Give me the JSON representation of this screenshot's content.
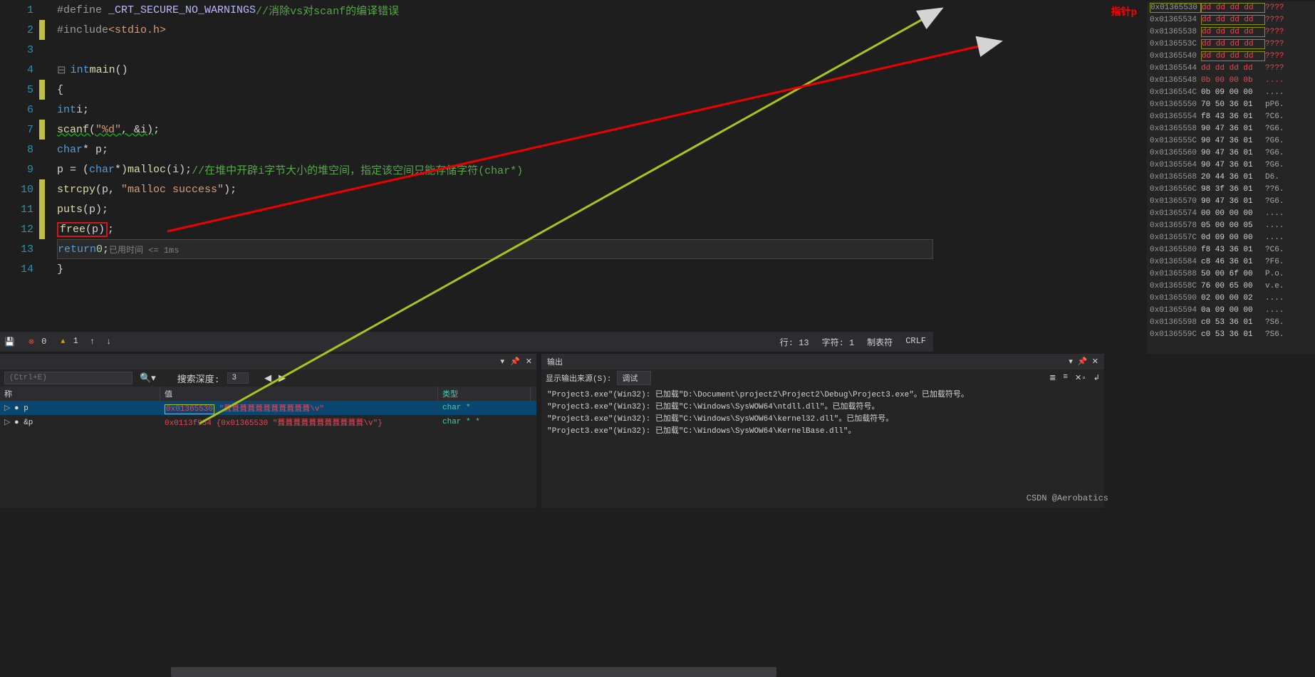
{
  "code": {
    "lines": [
      {
        "n": "1",
        "bk": false,
        "html": "<span class='c-dir'>#define </span><span class='c-mac'>_CRT_SECURE_NO_WARNINGS</span> <span class='c-cmt'>//消除vs对scanf的编译错误</span>"
      },
      {
        "n": "2",
        "bk": true,
        "html": "<span class='c-dir'>#include</span><span class='c-str'>&lt;stdio.h&gt;</span>"
      },
      {
        "n": "3",
        "bk": false,
        "html": ""
      },
      {
        "n": "4",
        "bk": false,
        "html": "<span class='collapse'>⊟</span><span class='c-kw'>int</span> <span class='c-fn'>main</span><span class='c-id'>()</span>"
      },
      {
        "n": "5",
        "bk": true,
        "html": "<span class='c-id'>{</span>"
      },
      {
        "n": "6",
        "bk": false,
        "html": "    <span class='c-kw'>int</span> <span class='c-id'>i;</span>"
      },
      {
        "n": "7",
        "bk": true,
        "html": "    <span class='c-fn squig'>scanf</span><span class='c-id squig'>(</span><span class='c-str squig'>\"%d\"</span><span class='c-id squig'>, &amp;i)</span><span class='c-id'>;</span>"
      },
      {
        "n": "8",
        "bk": false,
        "html": "    <span class='c-kw'>char</span><span class='c-id'>* p;</span>"
      },
      {
        "n": "9",
        "bk": false,
        "html": "    <span class='c-id'>p = (</span><span class='c-kw'>char</span><span class='c-id'>*)</span><span class='c-fn'>malloc</span><span class='c-id'>(i);</span>    <span class='c-cmt'>//在堆中开辟i字节大小的堆空间，指定该空间只能存储字符(char*)</span>"
      },
      {
        "n": "10",
        "bk": true,
        "html": "    <span class='c-fn'>strcpy</span><span class='c-id'>(p, </span><span class='c-str'>\"malloc success\"</span><span class='c-id'>);</span>"
      },
      {
        "n": "11",
        "bk": true,
        "html": "    <span class='c-fn'>puts</span><span class='c-id'>(p);</span>"
      },
      {
        "n": "12",
        "bk": true,
        "html": "    <span class='redbox'><span class='c-fn'>free</span><span class='c-id'>(p)</span></span><span class='c-id'>;</span>"
      },
      {
        "n": "13",
        "bk": false,
        "hl": true,
        "html": "    <span class='c-kw'>return</span> <span class='c-num'>0</span><span class='c-id'>;</span>   <span class='timing'>已用时间 &lt;= 1ms</span>"
      },
      {
        "n": "14",
        "bk": false,
        "html": "<span class='c-id'>}</span>"
      }
    ]
  },
  "memory": [
    {
      "a": "0x01365530",
      "h": "dd dd dd dd",
      "s": "????",
      "dd": true,
      "b1": true,
      "b2": true
    },
    {
      "a": "0x01365534",
      "h": "dd dd dd dd",
      "s": "????",
      "dd": true,
      "b2": true
    },
    {
      "a": "0x01365538",
      "h": "dd dd dd dd",
      "s": "????",
      "dd": true,
      "b2": true
    },
    {
      "a": "0x0136553C",
      "h": "dd dd dd dd",
      "s": "????",
      "dd": true,
      "b2": true
    },
    {
      "a": "0x01365540",
      "h": "dd dd dd dd",
      "s": "????",
      "dd": true,
      "b2": true
    },
    {
      "a": "0x01365544",
      "h": "dd dd dd dd",
      "s": "????",
      "dd": true
    },
    {
      "a": "0x01365548",
      "h": "0b 00 00 0b",
      "s": "....",
      "dd": true
    },
    {
      "a": "0x0136554C",
      "h": "0b 09 00 00",
      "s": "...."
    },
    {
      "a": "0x01365550",
      "h": "70 50 36 01",
      "s": "pP6."
    },
    {
      "a": "0x01365554",
      "h": "f8 43 36 01",
      "s": "?C6."
    },
    {
      "a": "0x01365558",
      "h": "90 47 36 01",
      "s": "?G6."
    },
    {
      "a": "0x0136555C",
      "h": "90 47 36 01",
      "s": "?G6."
    },
    {
      "a": "0x01365560",
      "h": "90 47 36 01",
      "s": "?G6."
    },
    {
      "a": "0x01365564",
      "h": "90 47 36 01",
      "s": "?G6."
    },
    {
      "a": "0x01365568",
      "h": "20 44 36 01",
      "s": " D6."
    },
    {
      "a": "0x0136556C",
      "h": "98 3f 36 01",
      "s": "??6."
    },
    {
      "a": "0x01365570",
      "h": "90 47 36 01",
      "s": "?G6."
    },
    {
      "a": "0x01365574",
      "h": "00 00 00 00",
      "s": "...."
    },
    {
      "a": "0x01365578",
      "h": "05 00 00 05",
      "s": "...."
    },
    {
      "a": "0x0136557C",
      "h": "0d 09 00 00",
      "s": "...."
    },
    {
      "a": "0x01365580",
      "h": "f8 43 36 01",
      "s": "?C6."
    },
    {
      "a": "0x01365584",
      "h": "c8 46 36 01",
      "s": "?F6."
    },
    {
      "a": "0x01365588",
      "h": "50 00 6f 00",
      "s": "P.o."
    },
    {
      "a": "0x0136558C",
      "h": "76 00 65 00",
      "s": "v.e."
    },
    {
      "a": "0x01365590",
      "h": "02 00 00 02",
      "s": "...."
    },
    {
      "a": "0x01365594",
      "h": "0a 09 00 00",
      "s": "...."
    },
    {
      "a": "0x01365598",
      "h": "c0 53 36 01",
      "s": "?S6."
    },
    {
      "a": "0x0136559C",
      "h": "c0 53 36 01",
      "s": "?S6."
    }
  ],
  "status": {
    "errors": "0",
    "warnings": "1",
    "line": "行: 13",
    "col": "字符: 1",
    "tab": "制表符",
    "crlf": "CRLF"
  },
  "autos": {
    "search_ph": "(Ctrl+E)",
    "depth_lbl": "搜索深度:",
    "depth": "3",
    "cols": {
      "name": "称",
      "val": "值",
      "type": "类型"
    },
    "rows": [
      {
        "n": "p",
        "v1": "0x01365530",
        "v2": "\"葺葺葺葺葺葺葺葺葺葺葺\\v\"",
        "t": "char *",
        "sel": true
      },
      {
        "n": "&p",
        "v1": "0x0113f954 {0x01365530 \"葺葺葺葺葺葺葺葺葺葺葺\\v\"}",
        "v2": "",
        "t": "char * *",
        "sel": false
      }
    ]
  },
  "output": {
    "tab": "输出",
    "src_lbl": "显示输出来源(S):",
    "src": "调试",
    "lines": [
      "\"Project3.exe\"(Win32): 已加载\"D:\\Document\\project2\\Project2\\Debug\\Project3.exe\"。已加载符号。",
      "\"Project3.exe\"(Win32): 已加载\"C:\\Windows\\SysWOW64\\ntdll.dll\"。已加载符号。",
      "\"Project3.exe\"(Win32): 已加载\"C:\\Windows\\SysWOW64\\kernel32.dll\"。已加载符号。",
      "\"Project3.exe\"(Win32): 已加载\"C:\\Windows\\SysWOW64\\KernelBase.dll\"。"
    ]
  },
  "anno": {
    "ptr": "指针p",
    "wm": "CSDN @Aerobatics"
  }
}
